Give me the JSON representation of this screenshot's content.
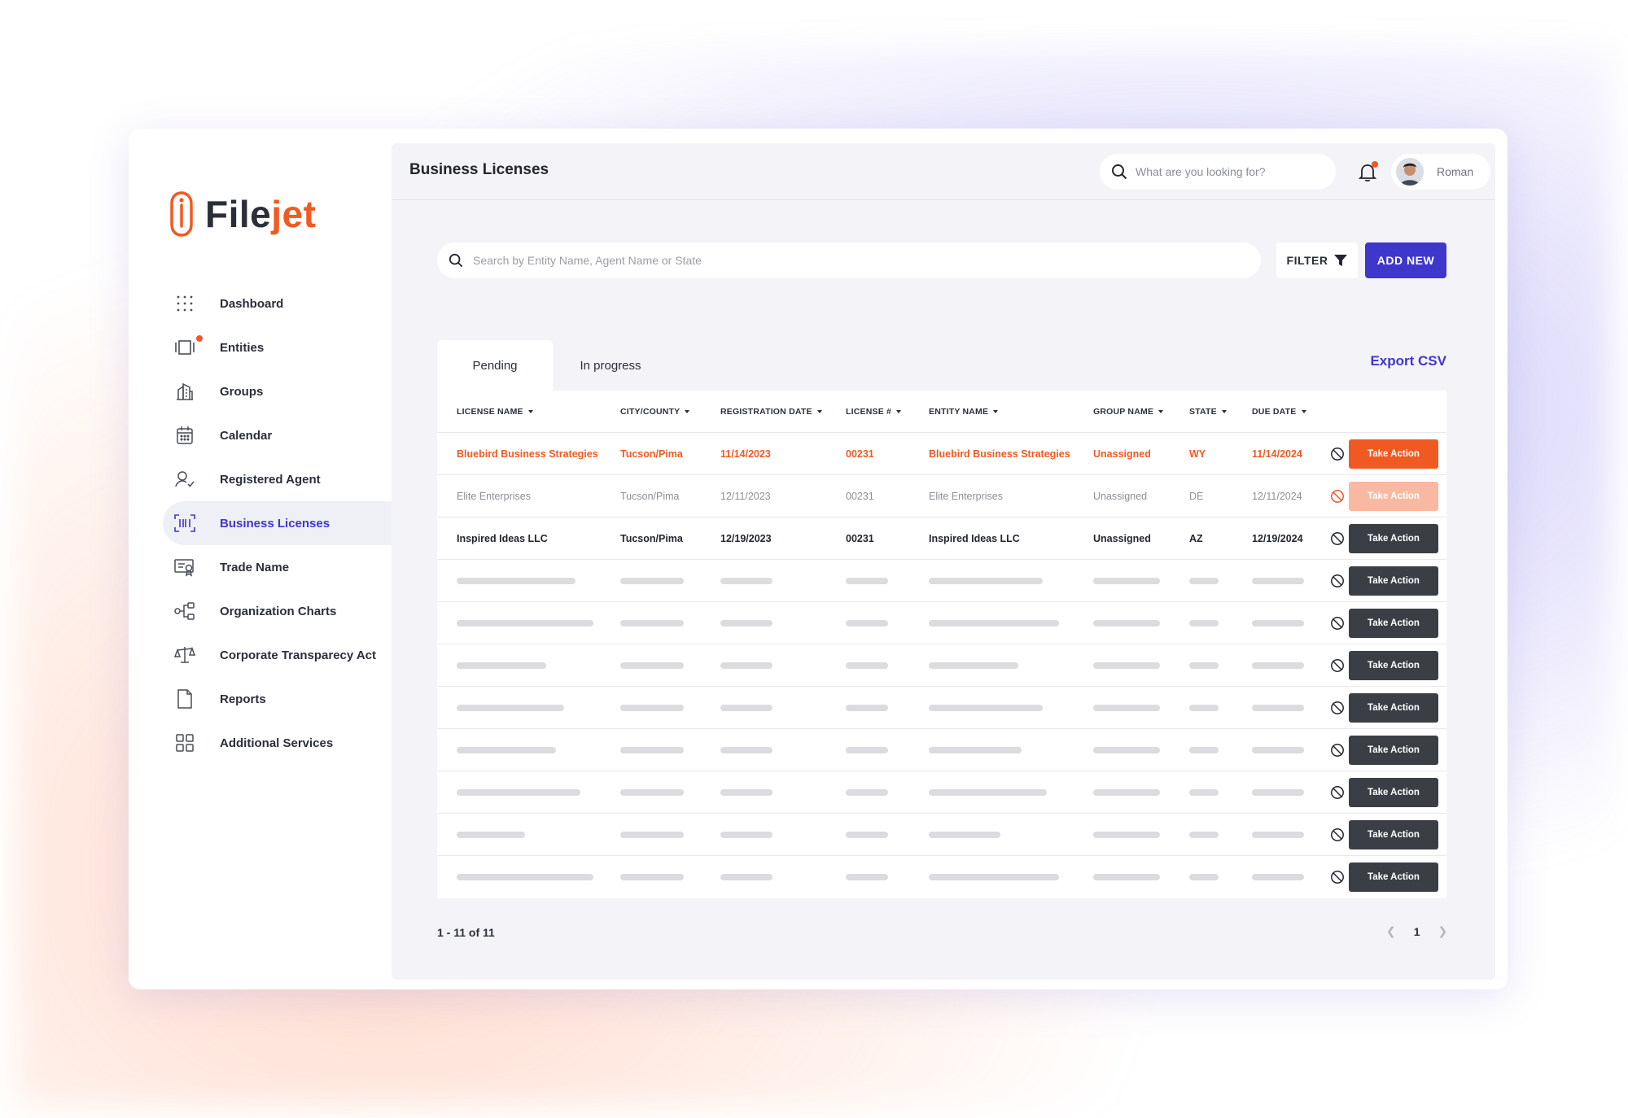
{
  "window": {
    "dots": [
      "#f0533f",
      "#f5c542",
      "#a79ef0"
    ]
  },
  "brand": {
    "part1": "File",
    "part2": "jet",
    "accent": "#f05a22",
    "primary": "#3f36cc"
  },
  "sidebar": {
    "items": [
      {
        "label": "Dashboard",
        "icon": "dots-grid-icon"
      },
      {
        "label": "Entities",
        "icon": "entities-icon"
      },
      {
        "label": "Groups",
        "icon": "building-icon"
      },
      {
        "label": "Calendar",
        "icon": "calendar-icon"
      },
      {
        "label": "Registered Agent",
        "icon": "user-check-icon"
      },
      {
        "label": "Business Licenses",
        "icon": "barcode-icon",
        "active": true
      },
      {
        "label": "Trade Name",
        "icon": "certificate-icon"
      },
      {
        "label": "Organization Charts",
        "icon": "org-chart-icon"
      },
      {
        "label": "Corporate Transparecy Act",
        "icon": "scale-icon"
      },
      {
        "label": "Reports",
        "icon": "file-icon"
      },
      {
        "label": "Additional Services",
        "icon": "grid-icon"
      }
    ]
  },
  "header": {
    "title": "Business Licenses",
    "search_placeholder": "What are you looking for?",
    "user_name": "Roman"
  },
  "toolbar": {
    "search_placeholder": "Search by Entity Name, Agent Name or State",
    "filter_label": "FILTER",
    "add_label": "ADD NEW"
  },
  "tabs": [
    {
      "label": "Pending",
      "active": true
    },
    {
      "label": "In progress",
      "active": false
    }
  ],
  "export_label": "Export CSV",
  "table": {
    "columns": [
      "LICENSE NAME",
      "CITY/COUNTY",
      "REGISTRATION DATE",
      "LICENSE #",
      "ENTITY NAME",
      "GROUP NAME",
      "STATE",
      "DUE DATE"
    ],
    "rows": [
      {
        "style": "orange",
        "cells": [
          "Bluebird Business Strategies",
          "Tucson/Pima",
          "11/14/2023",
          "00231",
          "Bluebird Business Strategies",
          "Unassigned",
          "WY",
          "11/14/2024"
        ],
        "action": "Take Action"
      },
      {
        "style": "grey",
        "cells": [
          "Elite Enterprises",
          "Tucson/Pima",
          "12/11/2023",
          "00231",
          "Elite Enterprises",
          "Unassigned",
          "DE",
          "12/11/2024"
        ],
        "action": "Take Action"
      },
      {
        "style": "dark",
        "cells": [
          "Inspired Ideas LLC",
          "Tucson/Pima",
          "12/19/2023",
          "00231",
          "Inspired Ideas LLC",
          "Unassigned",
          "AZ",
          "12/19/2024"
        ],
        "action": "Take Action"
      }
    ],
    "placeholder_rows": 8,
    "placeholder_action": "Take Action"
  },
  "pagination": {
    "summary": "1 - 11 of 11",
    "page": "1"
  }
}
